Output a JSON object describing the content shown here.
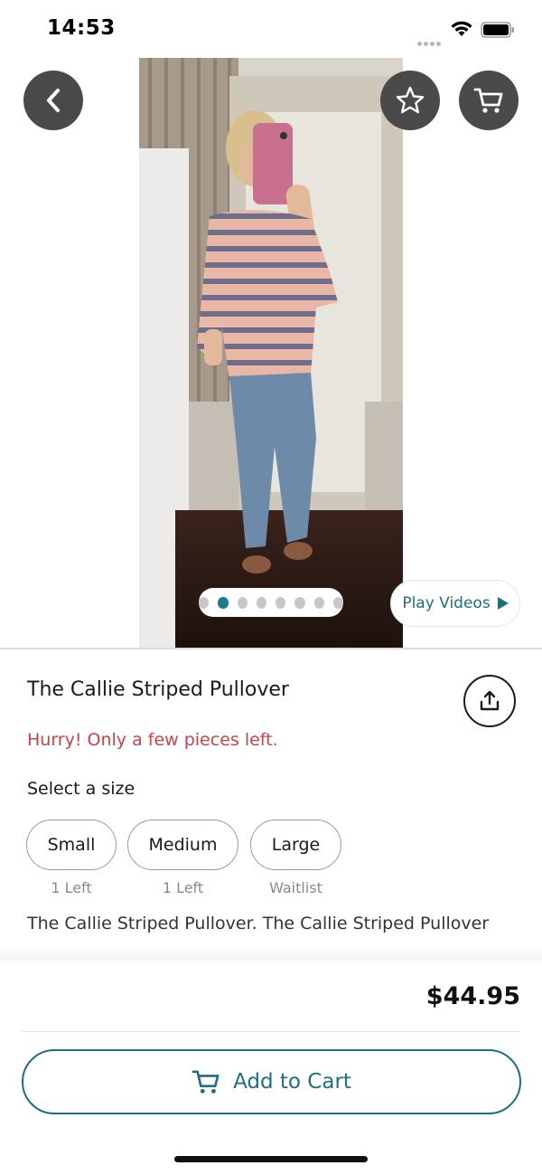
{
  "status_bar": {
    "time": "14:53"
  },
  "product": {
    "title": "The Callie Striped Pullover",
    "urgency": "Hurry! Only a few pieces left.",
    "description": "The Callie Striped Pullover. The Callie Striped Pullover",
    "price": "$44.95"
  },
  "gallery": {
    "page_count": 8,
    "active_index": 1,
    "play_videos_label": "Play Videos"
  },
  "sizes": {
    "label": "Select a size",
    "options": [
      {
        "label": "Small",
        "stock": "1 Left"
      },
      {
        "label": "Medium",
        "stock": "1 Left"
      },
      {
        "label": "Large",
        "stock": "Waitlist"
      }
    ]
  },
  "actions": {
    "add_to_cart_label": "Add to Cart"
  },
  "icons": {
    "back": "chevron-left-icon",
    "favorite": "star-icon",
    "cart": "cart-icon",
    "share": "share-icon",
    "play": "play-icon"
  },
  "colors": {
    "accent": "#1e6f80",
    "urgency": "#c8424c",
    "overlay_button": "#4a4a4a"
  }
}
